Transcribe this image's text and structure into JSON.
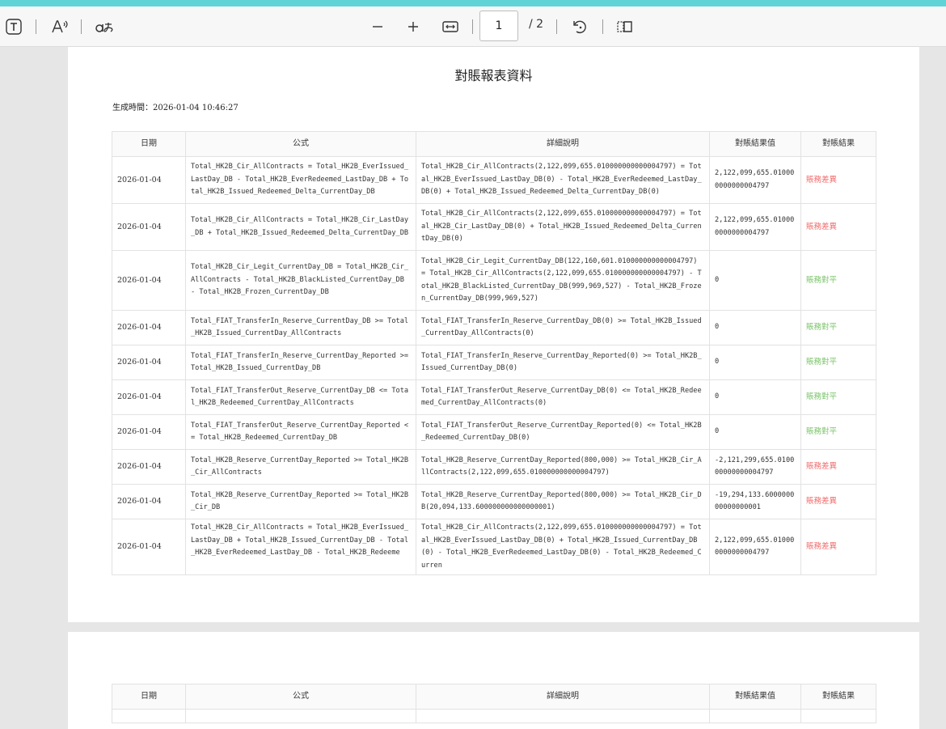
{
  "toolbar": {
    "text_icon": "text-icon",
    "read_aloud_icon": "read-aloud-icon",
    "translate_icon": "translate-icon",
    "zoom_out_icon": "minus-icon",
    "zoom_in_icon": "plus-icon",
    "fit_width_icon": "fit-width-icon",
    "current_page": "1",
    "total_pages": "/ 2",
    "rotate_icon": "rotate-icon",
    "page_view_icon": "two-page-icon"
  },
  "colors": {
    "accent": "#5fd3d6",
    "diff": "#f26d6d",
    "ok": "#7cc46a"
  },
  "report": {
    "title": "對賬報表資料",
    "generated": "生成時間：2026-01-04 10:46:27",
    "headers": [
      "日期",
      "公式",
      "詳細說明",
      "對賬結果值",
      "對賬結果"
    ],
    "rows": [
      {
        "date": "2026-01-04",
        "formula": "Total_HK2B_Cir_AllContracts = Total_HK2B_EverIssued_LastDay_DB - Total_HK2B_EverRedeemed_LastDay_DB + Total_HK2B_Issued_Redeemed_Delta_CurrentDay_DB",
        "detail": "Total_HK2B_Cir_AllContracts(2,122,099,655.010000000000004797) = Total_HK2B_EverIssued_LastDay_DB(0) - Total_HK2B_EverRedeemed_LastDay_DB(0) + Total_HK2B_Issued_Redeemed_Delta_CurrentDay_DB(0)",
        "value": "2,122,099,655.010000000000004797",
        "result": "賬務差異",
        "status": "bad"
      },
      {
        "date": "2026-01-04",
        "formula": "Total_HK2B_Cir_AllContracts = Total_HK2B_Cir_LastDay_DB + Total_HK2B_Issued_Redeemed_Delta_CurrentDay_DB",
        "detail": "Total_HK2B_Cir_AllContracts(2,122,099,655.010000000000004797) = Total_HK2B_Cir_LastDay_DB(0) + Total_HK2B_Issued_Redeemed_Delta_CurrentDay_DB(0)",
        "value": "2,122,099,655.010000000000004797",
        "result": "賬務差異",
        "status": "bad"
      },
      {
        "date": "2026-01-04",
        "formula": "Total_HK2B_Cir_Legit_CurrentDay_DB = Total_HK2B_Cir_AllContracts - Total_HK2B_BlackListed_CurrentDay_DB - Total_HK2B_Frozen_CurrentDay_DB",
        "detail": "Total_HK2B_Cir_Legit_CurrentDay_DB(122,160,601.010000000000004797) = Total_HK2B_Cir_AllContracts(2,122,099,655.010000000000004797) - Total_HK2B_BlackListed_CurrentDay_DB(999,969,527) - Total_HK2B_Frozen_CurrentDay_DB(999,969,527)",
        "value": "0",
        "result": "賬務對平",
        "status": "ok"
      },
      {
        "date": "2026-01-04",
        "formula": "Total_FIAT_TransferIn_Reserve_CurrentDay_DB >= Total_HK2B_Issued_CurrentDay_AllContracts",
        "detail": "Total_FIAT_TransferIn_Reserve_CurrentDay_DB(0) >= Total_HK2B_Issued_CurrentDay_AllContracts(0)",
        "value": "0",
        "result": "賬務對平",
        "status": "ok"
      },
      {
        "date": "2026-01-04",
        "formula": "Total_FIAT_TransferIn_Reserve_CurrentDay_Reported >= Total_HK2B_Issued_CurrentDay_DB",
        "detail": "Total_FIAT_TransferIn_Reserve_CurrentDay_Reported(0) >= Total_HK2B_Issued_CurrentDay_DB(0)",
        "value": "0",
        "result": "賬務對平",
        "status": "ok"
      },
      {
        "date": "2026-01-04",
        "formula": "Total_FIAT_TransferOut_Reserve_CurrentDay_DB <= Total_HK2B_Redeemed_CurrentDay_AllContracts",
        "detail": "Total_FIAT_TransferOut_Reserve_CurrentDay_DB(0) <= Total_HK2B_Redeemed_CurrentDay_AllContracts(0)",
        "value": "0",
        "result": "賬務對平",
        "status": "ok"
      },
      {
        "date": "2026-01-04",
        "formula": "Total_FIAT_TransferOut_Reserve_CurrentDay_Reported <= Total_HK2B_Redeemed_CurrentDay_DB",
        "detail": "Total_FIAT_TransferOut_Reserve_CurrentDay_Reported(0) <= Total_HK2B_Redeemed_CurrentDay_DB(0)",
        "value": "0",
        "result": "賬務對平",
        "status": "ok"
      },
      {
        "date": "2026-01-04",
        "formula": "Total_HK2B_Reserve_CurrentDay_Reported >= Total_HK2B_Cir_AllContracts",
        "detail": "Total_HK2B_Reserve_CurrentDay_Reported(800,000) >= Total_HK2B_Cir_AllContracts(2,122,099,655.010000000000004797)",
        "value": "-2,121,299,655.010000000000004797",
        "result": "賬務差異",
        "status": "bad"
      },
      {
        "date": "2026-01-04",
        "formula": "Total_HK2B_Reserve_CurrentDay_Reported >= Total_HK2B_Cir_DB",
        "detail": "Total_HK2B_Reserve_CurrentDay_Reported(800,000) >= Total_HK2B_Cir_DB(20,094,133.600000000000000001)",
        "value": "-19,294,133.600000000000000001",
        "result": "賬務差異",
        "status": "bad"
      },
      {
        "date": "2026-01-04",
        "formula": "Total_HK2B_Cir_AllContracts = Total_HK2B_EverIssued_LastDay_DB + Total_HK2B_Issued_CurrentDay_DB - Total_HK2B_EverRedeemed_LastDay_DB - Total_HK2B_Redeeme",
        "detail": "Total_HK2B_Cir_AllContracts(2,122,099,655.010000000000004797) = Total_HK2B_EverIssued_LastDay_DB(0) + Total_HK2B_Issued_CurrentDay_DB(0) - Total_HK2B_EverRedeemed_LastDay_DB(0) - Total_HK2B_Redeemed_Curren",
        "value": "2,122,099,655.010000000000004797",
        "result": "賬務差異",
        "status": "bad"
      }
    ]
  },
  "page2": {
    "headers": [
      "日期",
      "公式",
      "詳細說明",
      "對賬結果值",
      "對賬結果"
    ]
  }
}
